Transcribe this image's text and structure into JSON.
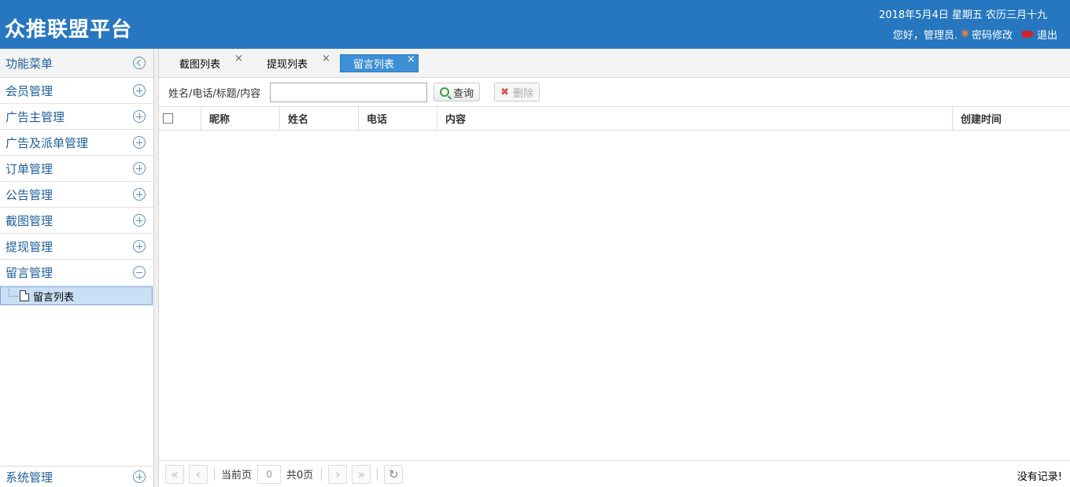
{
  "header": {
    "brand": "众推联盟平台",
    "date": "2018年5月4日 星期五 农历三月十九",
    "greeting": "您好，管理员.",
    "change_password": "密码修改",
    "logout": "退出"
  },
  "sidebar": {
    "title": "功能菜单",
    "items": [
      {
        "label": "会员管理"
      },
      {
        "label": "广告主管理"
      },
      {
        "label": "广告及派单管理"
      },
      {
        "label": "订单管理"
      },
      {
        "label": "公告管理"
      },
      {
        "label": "截图管理"
      },
      {
        "label": "提现管理"
      },
      {
        "label": "留言管理"
      }
    ],
    "expanded_child": "留言列表",
    "bottom_item": "系统管理"
  },
  "tabs": [
    {
      "label": "截图列表",
      "close": "×"
    },
    {
      "label": "提现列表",
      "close": "×"
    },
    {
      "label": "留言列表",
      "close": "×"
    }
  ],
  "toolbar": {
    "search_label": "姓名/电话/标题/内容",
    "search_value": "",
    "query_button": "查询",
    "delete_button": "删除"
  },
  "grid": {
    "columns": [
      "昵称",
      "姓名",
      "电话",
      "内容",
      "创建时间"
    ]
  },
  "pager": {
    "current_page_label": "当前页",
    "current_page_value": "0",
    "total_pages": "共0页",
    "no_records": "没有记录!"
  },
  "colors": {
    "header_bg": "#2777c0",
    "active_tab": "#3d8fd6",
    "menu_text": "#1f5f9e"
  }
}
